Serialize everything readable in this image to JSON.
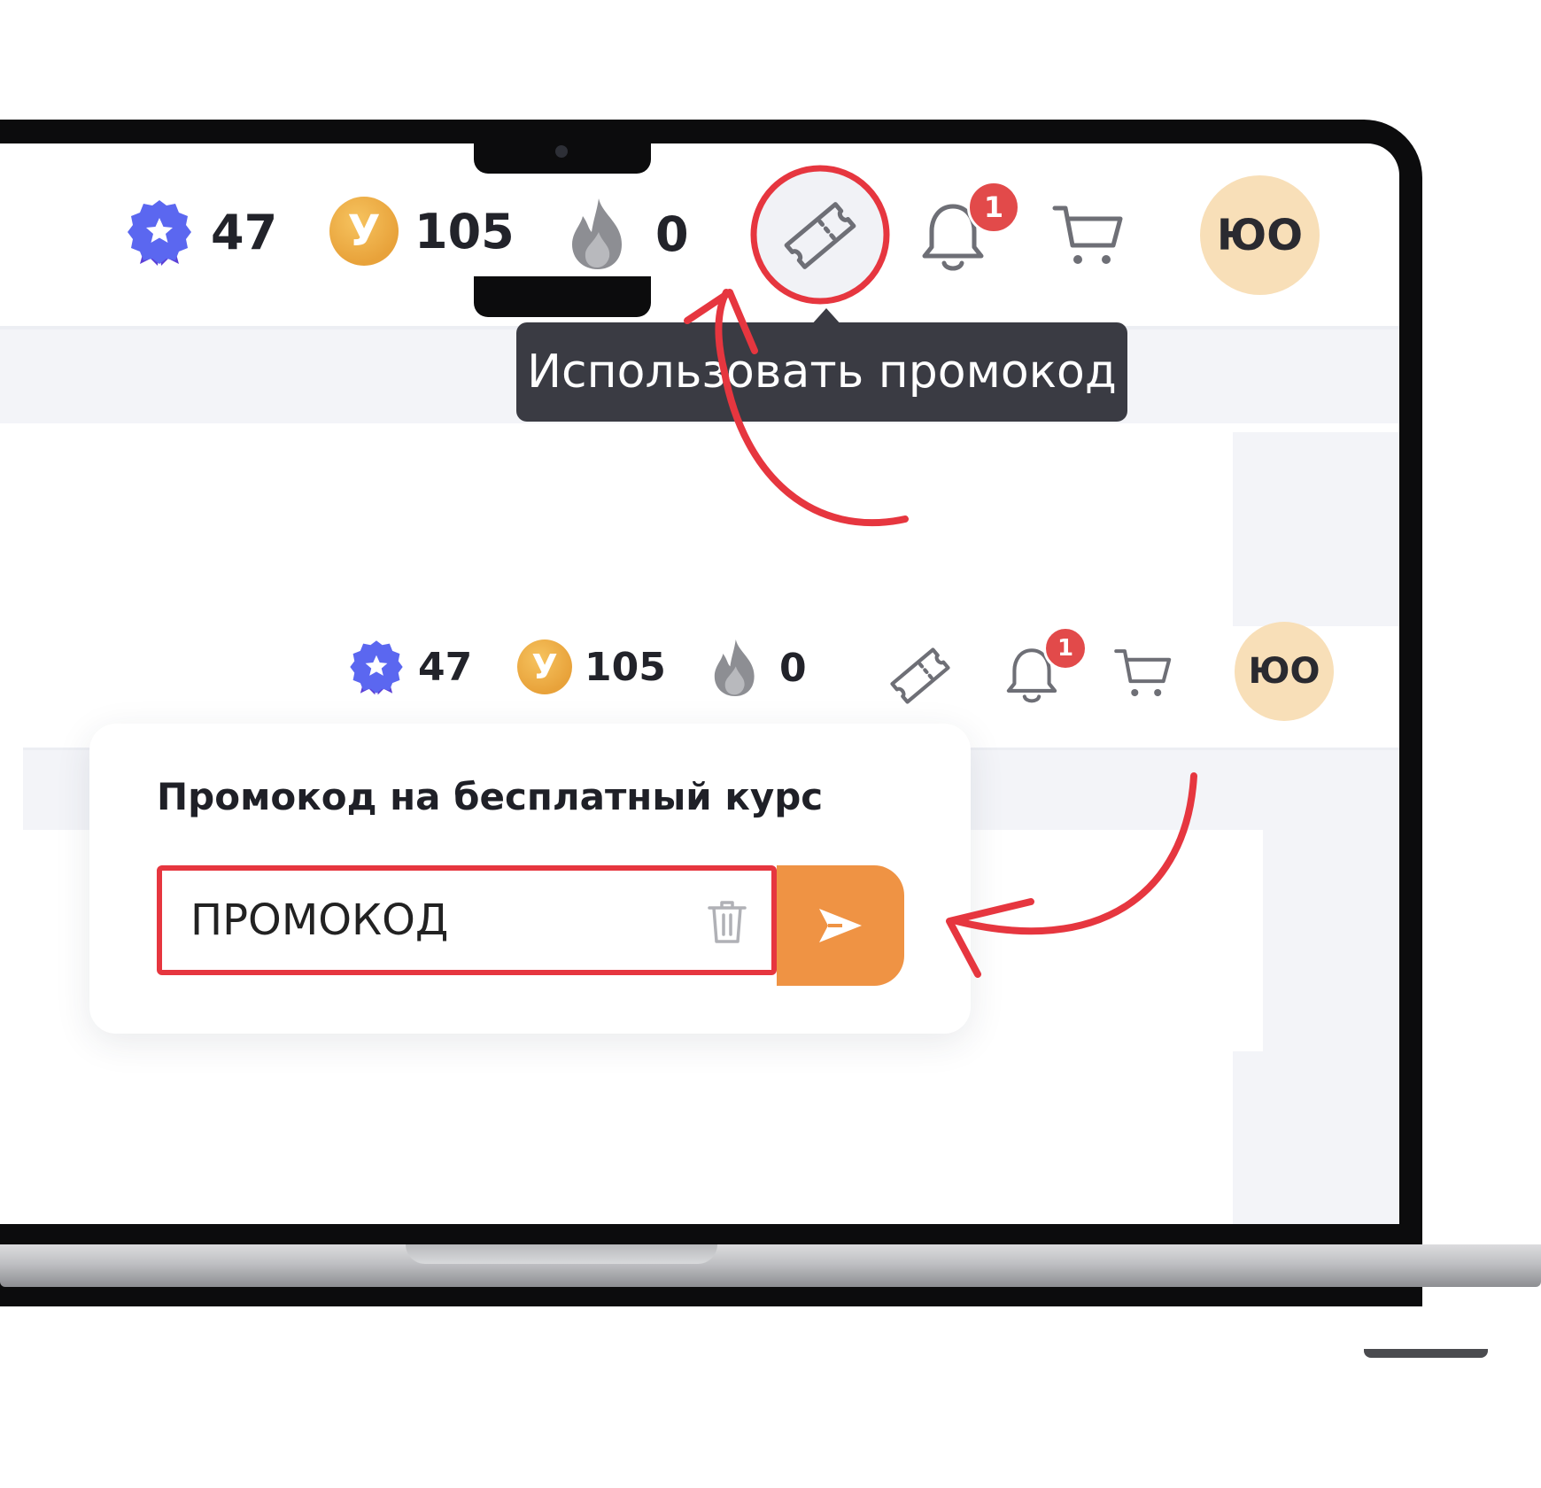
{
  "top_header": {
    "rating_value": "47",
    "coins_value": "105",
    "coin_letter": "У",
    "streak_value": "0",
    "notifications_count": "1",
    "avatar_initials": "ЮО",
    "promo_tooltip": "Использовать промокод"
  },
  "lower_header": {
    "rating_value": "47",
    "coins_value": "105",
    "coin_letter": "У",
    "streak_value": "0",
    "notifications_count": "1",
    "avatar_initials": "ЮО"
  },
  "promo_popup": {
    "title": "Промокод на бесплатный курс",
    "input_value": "ПРОМОКОД"
  },
  "colors": {
    "accent_orange": "#EF9344",
    "annotation_red": "#E6363F",
    "badge_purple": "#5B67F0",
    "avatar_bg": "#F8DFB8"
  },
  "icons": [
    "star-badge-icon",
    "coin-icon",
    "flame-icon",
    "ticket-icon",
    "bell-icon",
    "cart-icon",
    "trash-icon",
    "send-icon"
  ]
}
